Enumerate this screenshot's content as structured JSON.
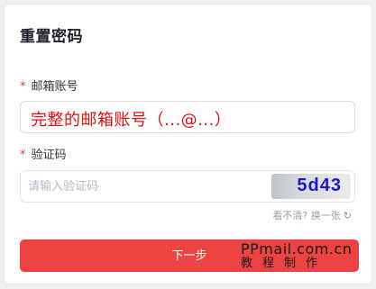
{
  "form": {
    "title": "重置密码",
    "email_label": "邮箱账号",
    "email_value": "完整的邮箱账号（...@...）",
    "code_label": "验证码",
    "code_placeholder": "请输入验证码",
    "captcha_text": "5d43",
    "refresh_text": "看不清? 换一张",
    "refresh_icon": "refresh-icon",
    "required_mark": "*",
    "next_label": "下一步"
  },
  "watermark": {
    "line1": "PPmail.com.cn",
    "line2": "教程制作"
  },
  "colors": {
    "accent": "#ee4343",
    "required": "#e53935",
    "email_text": "#e10f0f",
    "captcha_text": "#1a16d8"
  }
}
